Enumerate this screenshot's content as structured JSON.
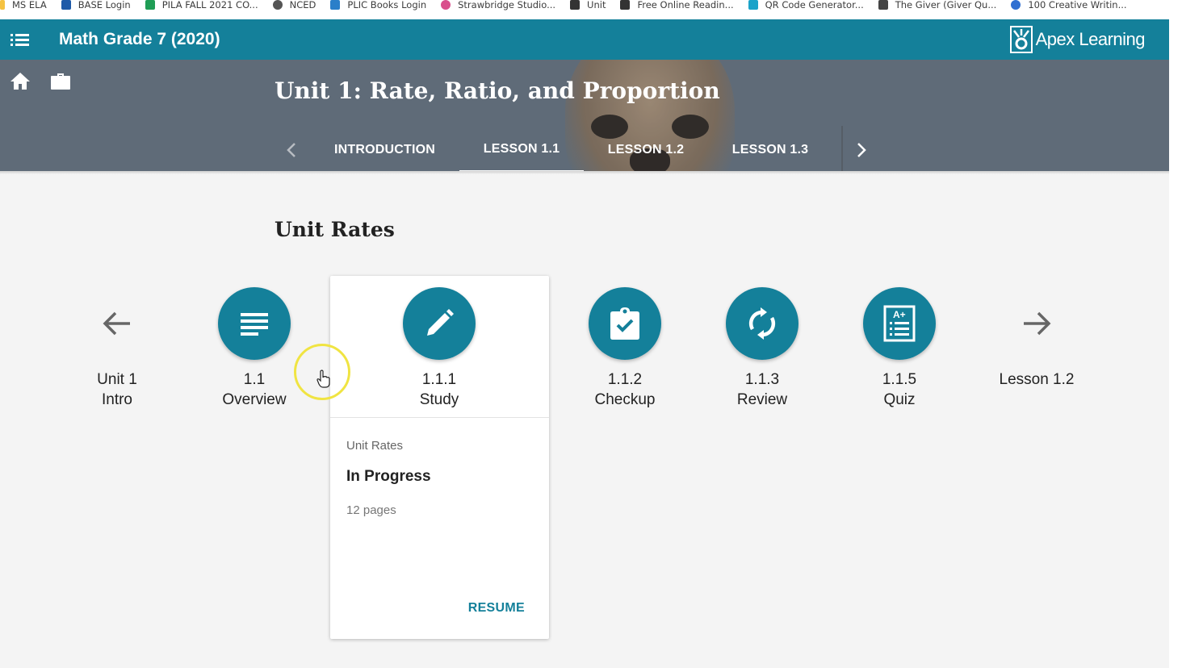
{
  "bookmarks": [
    {
      "label": "MS ELA",
      "color": "#f5c242"
    },
    {
      "label": "BASE Login",
      "color": "#1e5aa8"
    },
    {
      "label": "PILA FALL 2021 CO...",
      "color": "#1f9d55"
    },
    {
      "label": "NCED",
      "color": "#555555"
    },
    {
      "label": "PLIC Books Login",
      "color": "#2a7fc9"
    },
    {
      "label": "Strawbridge Studio...",
      "color": "#d94f8c"
    },
    {
      "label": "Unit",
      "color": "#333333"
    },
    {
      "label": "Free Online Readin...",
      "color": "#333333"
    },
    {
      "label": "QR Code Generator...",
      "color": "#1aa3c9"
    },
    {
      "label": "The Giver (Giver Qu...",
      "color": "#444444"
    },
    {
      "label": "100 Creative Writin...",
      "color": "#2f6fd1"
    }
  ],
  "header": {
    "course_title": "Math Grade 7 (2020)",
    "logo_text": "Apex Learning",
    "accent_color": "#14809a"
  },
  "banner": {
    "unit_title": "Unit 1: Rate, Ratio, and Proportion",
    "tabs": [
      {
        "label": "INTRODUCTION",
        "active": false
      },
      {
        "label": "LESSON 1.1",
        "active": true
      },
      {
        "label": "LESSON 1.2",
        "active": false
      },
      {
        "label": "LESSON 1.3",
        "active": false
      }
    ]
  },
  "lesson": {
    "title": "Unit Rates",
    "activities": [
      {
        "line1": "Unit 1",
        "line2": "Intro",
        "icon": "arrow-left-icon"
      },
      {
        "line1": "1.1",
        "line2": "Overview",
        "icon": "lines-icon"
      },
      {
        "line1": "1.1.1",
        "line2": "Study",
        "icon": "pencil-icon"
      },
      {
        "line1": "1.1.2",
        "line2": "Checkup",
        "icon": "clipboard-check-icon"
      },
      {
        "line1": "1.1.3",
        "line2": "Review",
        "icon": "refresh-icon"
      },
      {
        "line1": "1.1.5",
        "line2": "Quiz",
        "icon": "quiz-sheet-icon"
      },
      {
        "line1": "Lesson 1.2",
        "line2": "",
        "icon": "arrow-right-icon"
      }
    ],
    "card": {
      "subtitle": "Unit Rates",
      "status": "In Progress",
      "pages": "12 pages",
      "action": "RESUME"
    }
  }
}
